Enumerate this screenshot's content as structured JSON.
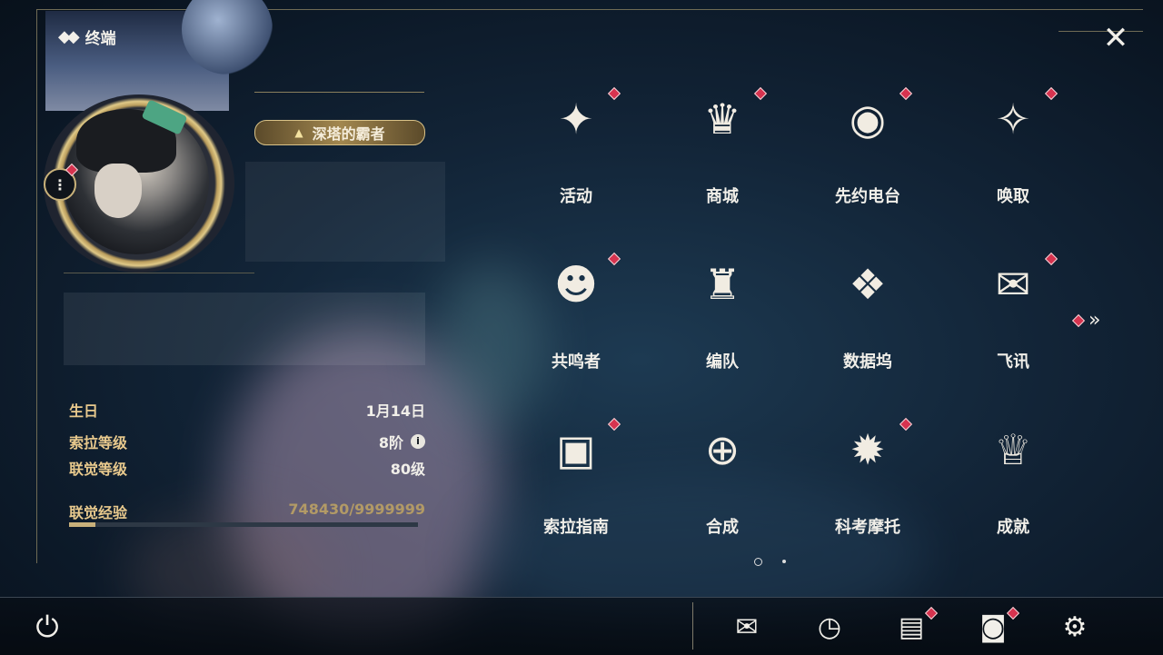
{
  "header": {
    "title": "终端"
  },
  "profile": {
    "title_badge": "深塔的霸者"
  },
  "stats": [
    {
      "label": "生日",
      "value": "1月14日"
    },
    {
      "label": "索拉等级",
      "value": "8阶"
    },
    {
      "label": "联觉等级",
      "value": "80级"
    }
  ],
  "experience": {
    "label": "联觉经验",
    "value": "748430/9999999",
    "progress": 0.0748
  },
  "grid": [
    {
      "label": "活动",
      "icon": "sparkle-icon",
      "glyph": "✦",
      "badge": true
    },
    {
      "label": "商城",
      "icon": "cart-icon",
      "glyph": "♛",
      "badge": true
    },
    {
      "label": "先约电台",
      "icon": "radio-icon",
      "glyph": "◉",
      "badge": true
    },
    {
      "label": "唤取",
      "icon": "compass-star-icon",
      "glyph": "✧",
      "badge": true
    },
    {
      "label": "共鸣者",
      "icon": "character-icon",
      "glyph": "☻",
      "badge": true
    },
    {
      "label": "编队",
      "icon": "chess-icon",
      "glyph": "♜",
      "badge": false
    },
    {
      "label": "数据坞",
      "icon": "databank-icon",
      "glyph": "❖",
      "badge": false
    },
    {
      "label": "飞讯",
      "icon": "message-icon",
      "glyph": "✉",
      "badge": true
    },
    {
      "label": "索拉指南",
      "icon": "guide-icon",
      "glyph": "▣",
      "badge": true
    },
    {
      "label": "合成",
      "icon": "synthesis-icon",
      "glyph": "⊕",
      "badge": false
    },
    {
      "label": "科考摩托",
      "icon": "motorbike-icon",
      "glyph": "✹",
      "badge": true
    },
    {
      "label": "成就",
      "icon": "trophy-icon",
      "glyph": "♕",
      "badge": false
    }
  ],
  "pager": {
    "pages": 2,
    "current": 1
  },
  "colors": {
    "accent": "#d6334f",
    "gold": "#c8b07a",
    "label_gold": "#e8c98d"
  }
}
